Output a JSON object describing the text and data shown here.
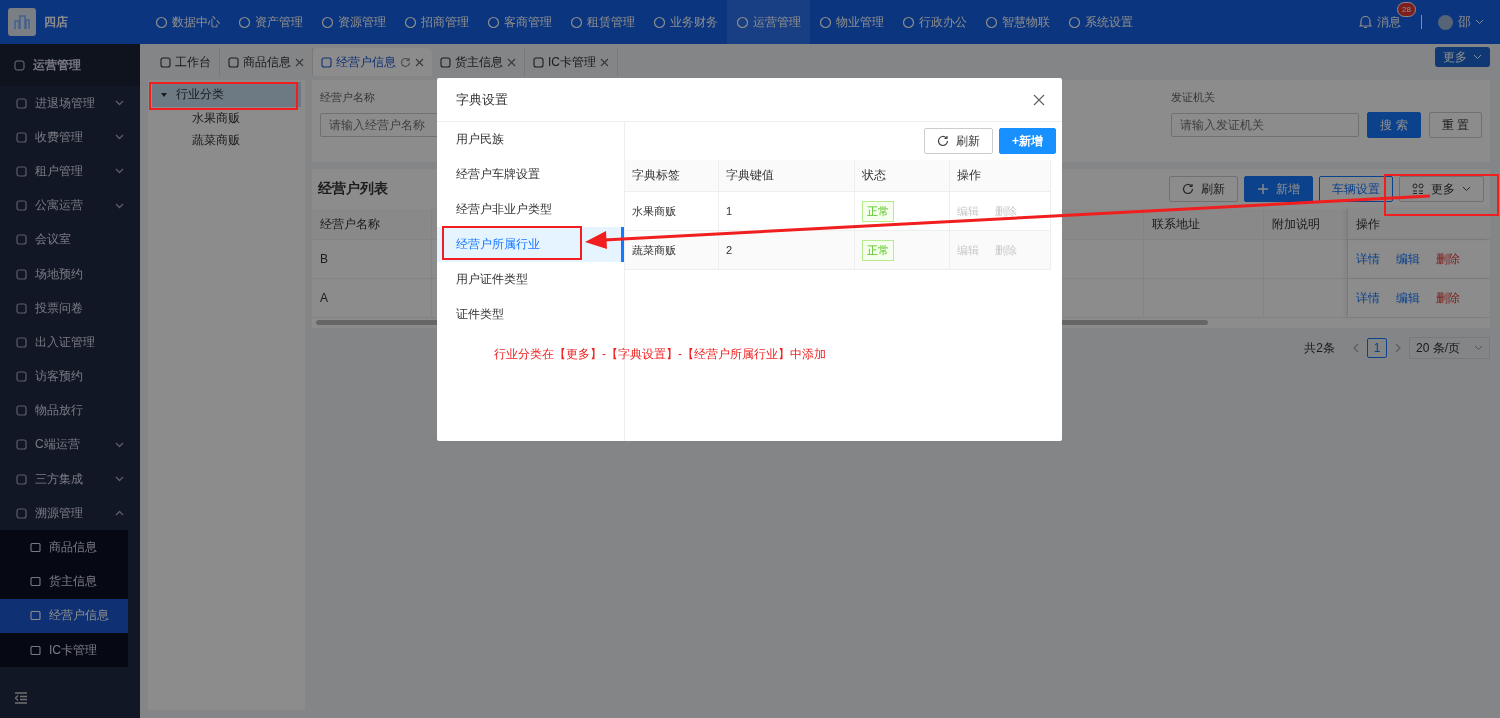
{
  "app": {
    "store": "四店"
  },
  "top_nav": [
    {
      "label": "数据中心",
      "selected": false
    },
    {
      "label": "资产管理",
      "selected": false
    },
    {
      "label": "资源管理",
      "selected": false
    },
    {
      "label": "招商管理",
      "selected": false
    },
    {
      "label": "客商管理",
      "selected": false
    },
    {
      "label": "租赁管理",
      "selected": false
    },
    {
      "label": "业务财务",
      "selected": false
    },
    {
      "label": "运营管理",
      "selected": true
    },
    {
      "label": "物业管理",
      "selected": false
    },
    {
      "label": "行政办公",
      "selected": false
    },
    {
      "label": "智慧物联",
      "selected": false
    },
    {
      "label": "系统设置",
      "selected": false
    }
  ],
  "notifications": {
    "label": "消息",
    "badge": "28"
  },
  "user": {
    "name": "邵"
  },
  "sidebar": {
    "title": "运营管理",
    "items": [
      {
        "label": "进退场管理",
        "kind": "group",
        "expanded": false
      },
      {
        "label": "收费管理",
        "kind": "group",
        "expanded": false
      },
      {
        "label": "租户管理",
        "kind": "group",
        "expanded": false
      },
      {
        "label": "公寓运营",
        "kind": "group",
        "expanded": false
      },
      {
        "label": "会议室",
        "kind": "link"
      },
      {
        "label": "场地预约",
        "kind": "link"
      },
      {
        "label": "投票问卷",
        "kind": "link"
      },
      {
        "label": "出入证管理",
        "kind": "link"
      },
      {
        "label": "访客预约",
        "kind": "link"
      },
      {
        "label": "物品放行",
        "kind": "link"
      },
      {
        "label": "C端运营",
        "kind": "group",
        "expanded": false
      },
      {
        "label": "三方集成",
        "kind": "group",
        "expanded": false
      },
      {
        "label": "溯源管理",
        "kind": "group",
        "expanded": true,
        "children": [
          {
            "label": "商品信息",
            "selected": false
          },
          {
            "label": "货主信息",
            "selected": false
          },
          {
            "label": "经营户信息",
            "selected": true
          },
          {
            "label": "IC卡管理",
            "selected": false
          }
        ]
      }
    ]
  },
  "tabs": [
    {
      "label": "工作台",
      "selected": false,
      "closable": false
    },
    {
      "label": "商品信息",
      "selected": false,
      "closable": true
    },
    {
      "label": "经营户信息",
      "selected": true,
      "closable": true
    },
    {
      "label": "货主信息",
      "selected": false,
      "closable": true
    },
    {
      "label": "IC卡管理",
      "selected": false,
      "closable": true
    }
  ],
  "tabs_more": "更多",
  "tree": [
    {
      "label": "行业分类",
      "expanded": true,
      "selected": true,
      "children": [
        {
          "label": "水果商贩",
          "selected": false
        },
        {
          "label": "蔬菜商贩",
          "selected": false
        }
      ]
    }
  ],
  "search": {
    "fields": [
      {
        "label": "经营户名称",
        "placeholder": "请输入经营户名称"
      },
      {
        "label": "发证机关",
        "placeholder": "请输入发证机关"
      }
    ],
    "search_button": "搜 索",
    "reset_button": "重 置"
  },
  "list": {
    "title": "经营户列表",
    "refresh": "刷新",
    "add": "新增",
    "vehicle": "车辆设置",
    "more": "更多",
    "columns": [
      "经营户名称",
      "联系地址",
      "附加说明",
      "操作"
    ],
    "rows": [
      {
        "name": "B",
        "actions": [
          {
            "label": "详情",
            "kind": "link"
          },
          {
            "label": "编辑",
            "kind": "link"
          },
          {
            "label": "删除",
            "kind": "danger"
          }
        ]
      },
      {
        "name": "A",
        "actions": [
          {
            "label": "详情",
            "kind": "link"
          },
          {
            "label": "编辑",
            "kind": "link"
          },
          {
            "label": "删除",
            "kind": "danger"
          }
        ]
      }
    ]
  },
  "pagination": {
    "total": "共2条",
    "pages": [
      {
        "label": "1",
        "selected": true
      }
    ],
    "page_size": "20 条/页"
  },
  "modal": {
    "title": "字典设置",
    "categories": [
      {
        "label": "用户民族",
        "selected": false
      },
      {
        "label": "经营户车牌设置",
        "selected": false
      },
      {
        "label": "经营户非业户类型",
        "selected": false
      },
      {
        "label": "经营户所属行业",
        "selected": true
      },
      {
        "label": "用户证件类型",
        "selected": false
      },
      {
        "label": "证件类型",
        "selected": false
      }
    ],
    "refresh": "刷新",
    "add": "+新增",
    "columns": [
      "字典标签",
      "字典键值",
      "状态",
      "操作"
    ],
    "rows": [
      {
        "label": "水果商贩",
        "value": "1",
        "status": "正常",
        "actions": [
          {
            "label": "编辑",
            "disabled": true
          },
          {
            "label": "删除",
            "disabled": true
          }
        ]
      },
      {
        "label": "蔬菜商贩",
        "value": "2",
        "status": "正常",
        "actions": [
          {
            "label": "编辑",
            "disabled": true
          },
          {
            "label": "删除",
            "disabled": true
          }
        ]
      }
    ]
  },
  "annotation": "行业分类在【更多】-【字典设置】-【经营户所属行业】中添加"
}
